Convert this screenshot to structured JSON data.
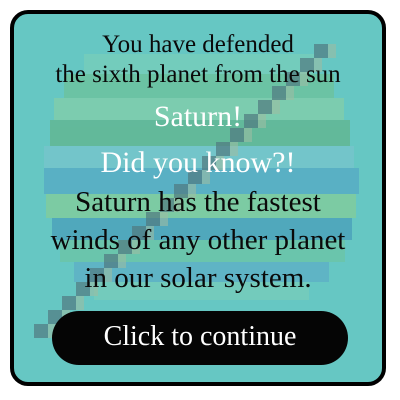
{
  "message": {
    "intro_line_1": "You have defended",
    "intro_line_2": "the sixth planet from the sun",
    "planet_name": "Saturn!",
    "did_you_know": "Did you know?!",
    "fact_line_1": "Saturn has the fastest",
    "fact_line_2": "winds of any other planet",
    "fact_line_3": "in our solar system."
  },
  "button": {
    "continue_label": "Click to continue"
  },
  "colors": {
    "panel_background": "#66c7c3",
    "border": "#000000",
    "button_background": "#050505",
    "button_text": "#ffffff",
    "highlight_text": "#ffffff",
    "body_text": "#0a0a0a"
  },
  "icons": {
    "background_art": "saturn-planet-icon"
  }
}
